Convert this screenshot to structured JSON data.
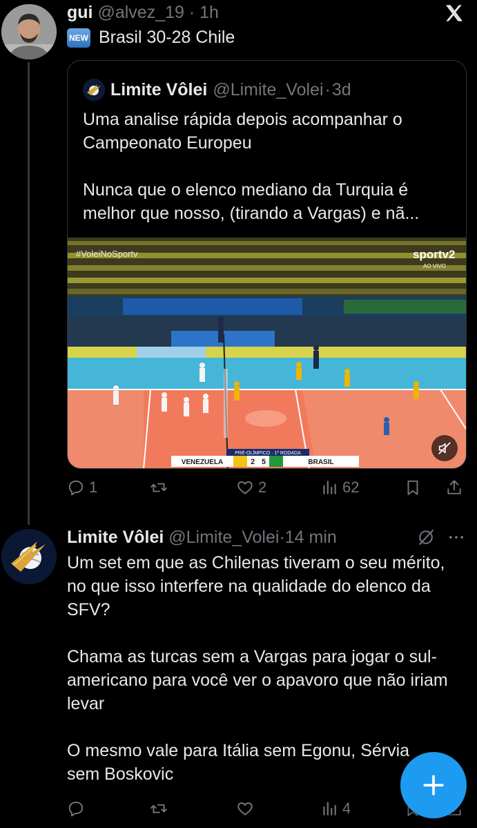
{
  "tweet1": {
    "name": "gui",
    "handle": "@alvez_19",
    "separator": "·",
    "time": "1h",
    "badge": "NEW",
    "text": "Brasil 30-28 Chile",
    "quote": {
      "name": "Limite Vôlei",
      "handle": "@Limite_Volei",
      "separator": "·",
      "time": "3d",
      "paragraph1": "Uma analise rápida depois acompanhar o Campeonato Europeu",
      "paragraph2": "Nunca que o elenco mediano da Turquia é melhor que nosso, (tirando a Vargas) e nã...",
      "media": {
        "hashtag": "#VoleiNoSportv",
        "channel": "sportv2",
        "live": "AO VIVO",
        "stage": "PRÉ-OLÍMPICO · 1ª RODADA",
        "team_left": "VENEZUELA",
        "score_left": "2",
        "score_right": "5",
        "team_right": "BRASIL"
      }
    },
    "actions": {
      "replies": "1",
      "retweets": "",
      "likes": "2",
      "views": "62"
    }
  },
  "tweet2": {
    "name": "Limite Vôlei",
    "handle": "@Limite_Volei",
    "separator": "·",
    "time": "14 min",
    "p1": "Um set em que as Chilenas tiveram o seu mérito, no que isso interfere na qualidade do elenco da SFV?",
    "p2": "Chama as turcas sem a Vargas para jogar o sul-americano para você ver o apavoro que não iriam levar",
    "p3": "O mesmo vale para Itália sem Egonu, Sérvia sem Boskovic",
    "actions": {
      "replies": "",
      "retweets": "",
      "likes": "",
      "views": "4"
    }
  },
  "icons": {
    "x_logo": "x-logo-icon",
    "reply": "reply-icon",
    "retweet": "retweet-icon",
    "like": "heart-icon",
    "views": "analytics-icon",
    "bookmark": "bookmark-icon",
    "share": "share-icon",
    "more": "more-icon",
    "grok": "grok-icon",
    "mute": "mute-icon",
    "compose": "plus-icon"
  },
  "colors": {
    "background": "#000000",
    "text": "#e7e9ea",
    "muted": "#71767b",
    "accent": "#1d9bf0",
    "border": "#2f3336"
  }
}
